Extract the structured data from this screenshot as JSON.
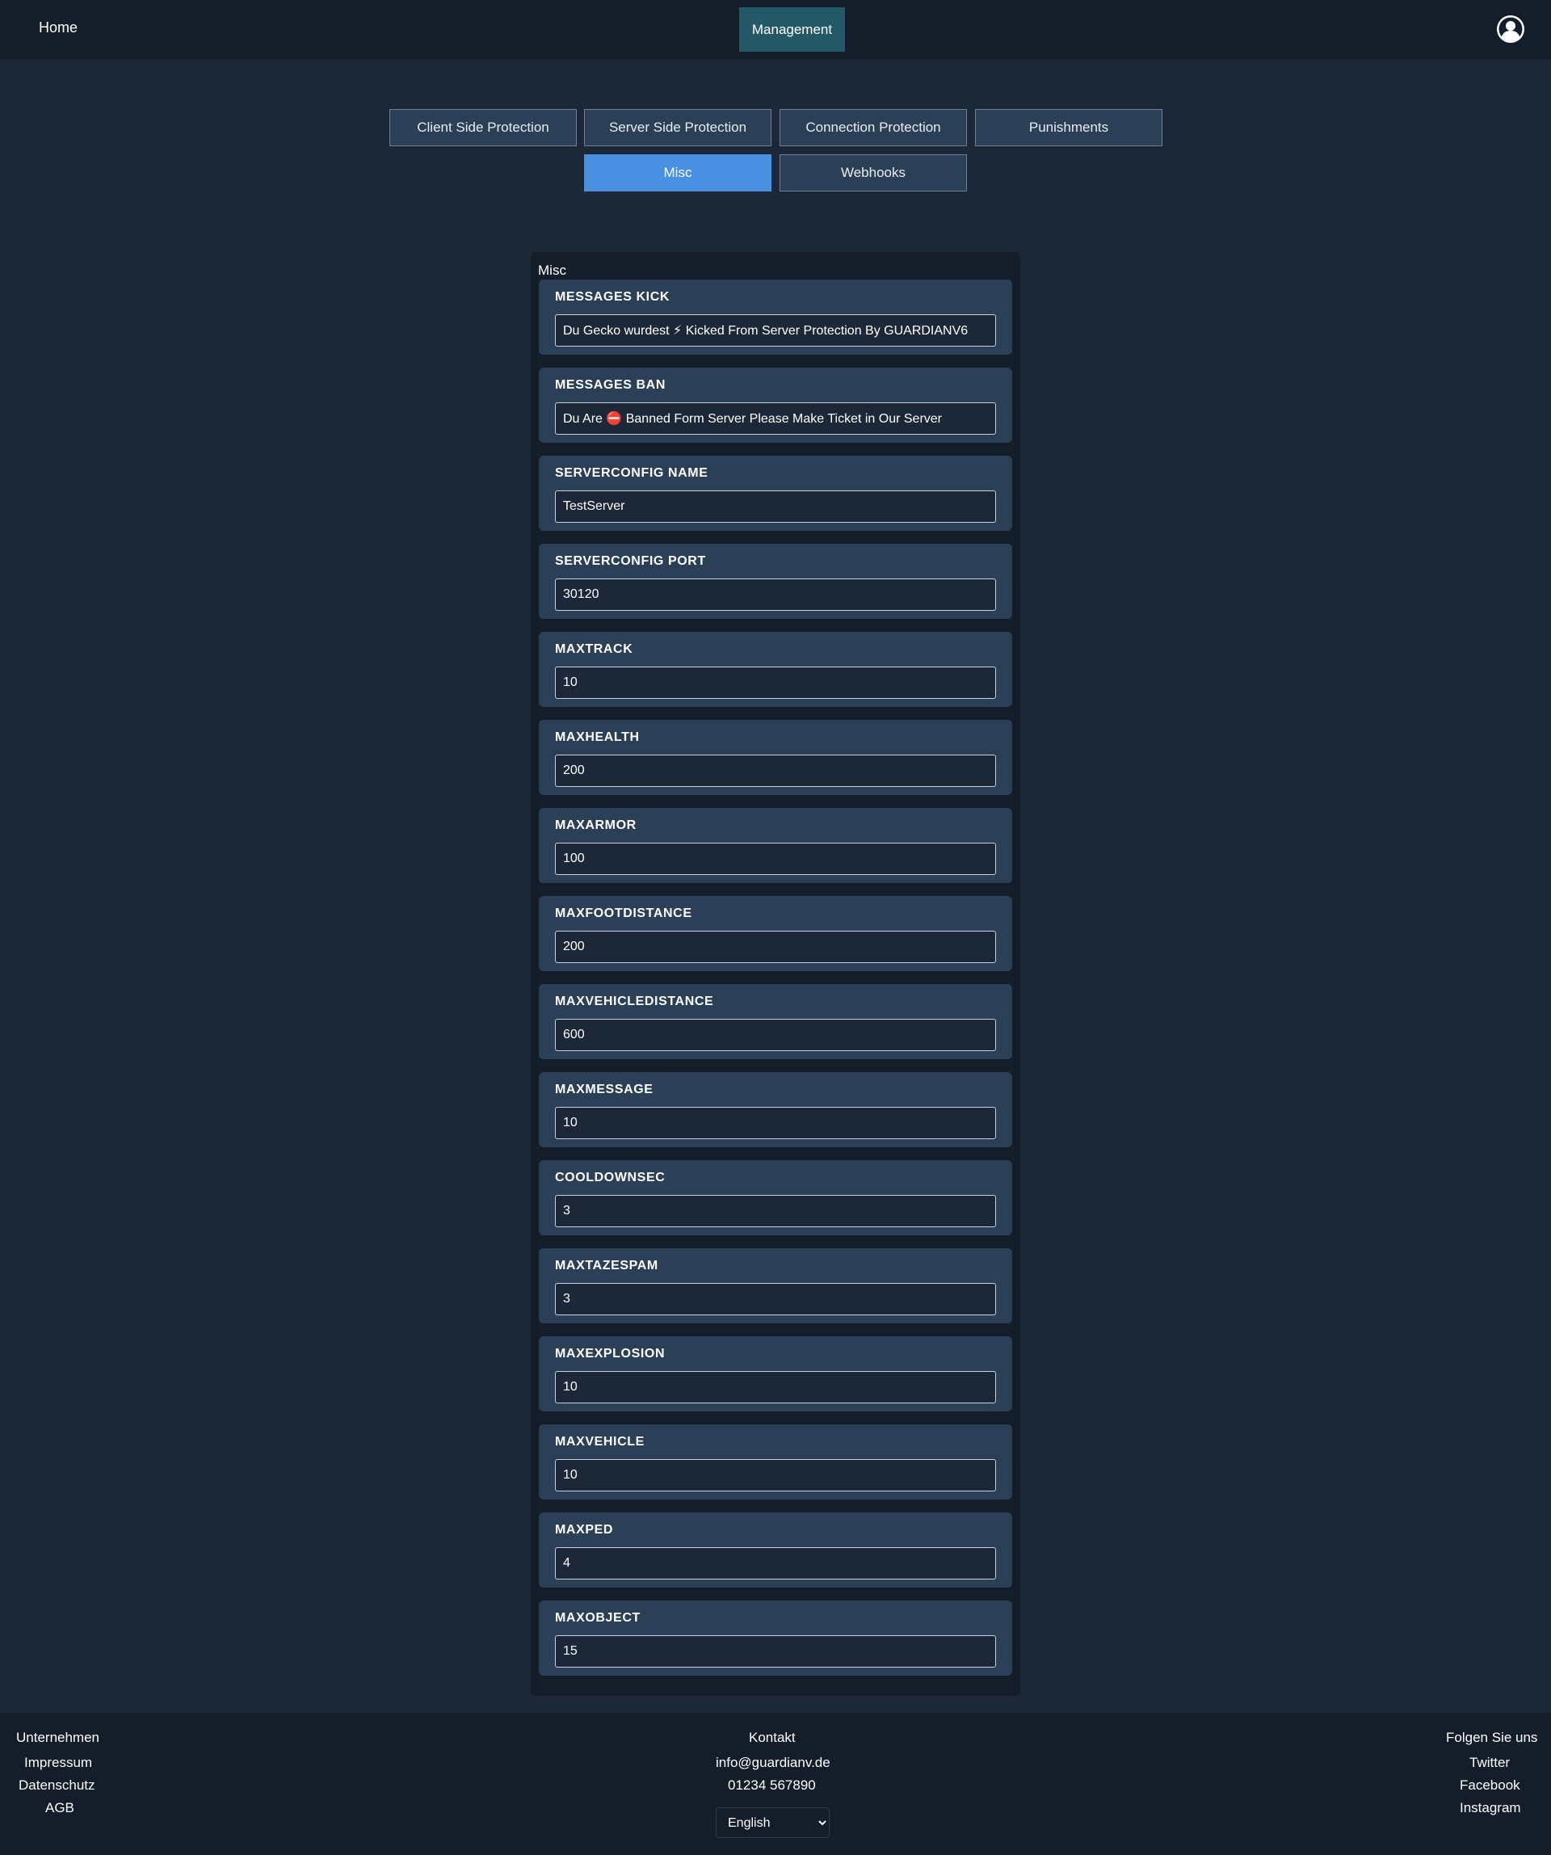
{
  "nav": {
    "home_label": "Home",
    "management_label": "Management",
    "avatar_icon": "user-circle-icon"
  },
  "tabs": [
    {
      "label": "Client Side Protection",
      "active": false
    },
    {
      "label": "Server Side Protection",
      "active": false
    },
    {
      "label": "Connection Protection",
      "active": false
    },
    {
      "label": "Punishments",
      "active": false
    },
    {
      "label": "Misc",
      "active": true
    },
    {
      "label": "Webhooks",
      "active": false
    }
  ],
  "panel": {
    "title": "Misc",
    "fields": [
      {
        "label": "MESSAGES KICK",
        "value": "Du Gecko wurdest ⚡ Kicked From Server Protection By GUARDIANV6"
      },
      {
        "label": "MESSAGES BAN",
        "value": "Du Are ⛔ Banned Form Server Please Make Ticket in Our Server"
      },
      {
        "label": "SERVERCONFIG NAME",
        "value": "TestServer"
      },
      {
        "label": "SERVERCONFIG PORT",
        "value": "30120"
      },
      {
        "label": "MAXTRACK",
        "value": "10"
      },
      {
        "label": "MAXHEALTH",
        "value": "200"
      },
      {
        "label": "MAXARMOR",
        "value": "100"
      },
      {
        "label": "MAXFOOTDISTANCE",
        "value": "200"
      },
      {
        "label": "MAXVEHICLEDISTANCE",
        "value": "600"
      },
      {
        "label": "MAXMESSAGE",
        "value": "10"
      },
      {
        "label": "COOLDOWNSEC",
        "value": "3"
      },
      {
        "label": "MAXTAZESPAM",
        "value": "3"
      },
      {
        "label": "MAXEXPLOSION",
        "value": "10"
      },
      {
        "label": "MAXVEHICLE",
        "value": "10"
      },
      {
        "label": "MAXPED",
        "value": "4"
      },
      {
        "label": "MAXOBJECT",
        "value": "15"
      }
    ]
  },
  "footer": {
    "company": {
      "heading": "Unternehmen",
      "links": [
        "Impressum",
        "Datenschutz",
        "AGB"
      ]
    },
    "contact": {
      "heading": "Kontakt",
      "email": "info@guardianv.de",
      "phone": "01234 567890",
      "language": "English"
    },
    "social": {
      "heading": "Folgen Sie uns",
      "links": [
        "Twitter",
        "Facebook",
        "Instagram"
      ]
    }
  },
  "colors": {
    "background": "#1c2838",
    "topbar": "#141e2b",
    "management_active": "#235866",
    "tab_active": "#4a90e2",
    "card": "#2b3f57"
  }
}
